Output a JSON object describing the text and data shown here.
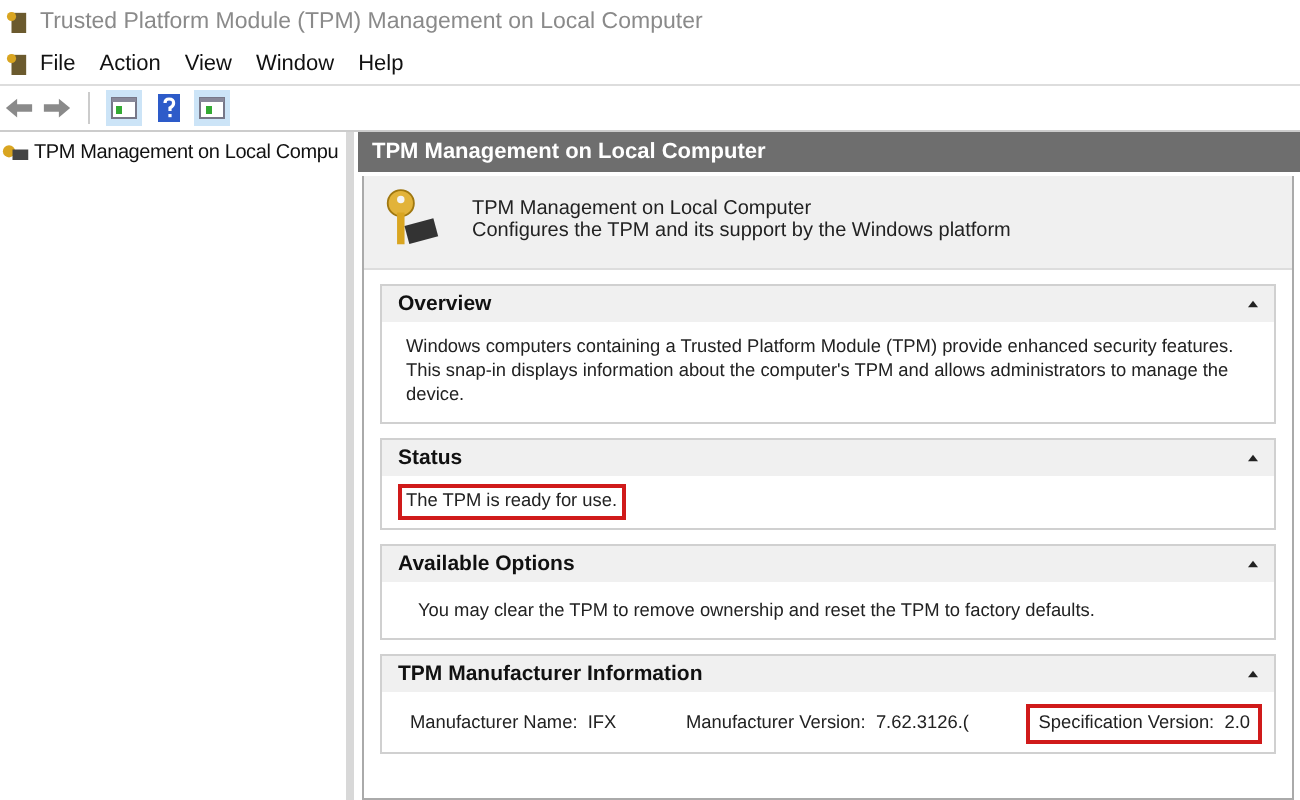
{
  "window": {
    "title": "Trusted Platform Module (TPM) Management on Local Computer"
  },
  "menu": [
    "File",
    "Action",
    "View",
    "Window",
    "Help"
  ],
  "tree": {
    "items": [
      {
        "label": "TPM Management on Local Compu",
        "selected": false
      }
    ]
  },
  "pane": {
    "header": "TPM Management on Local Computer",
    "info_title": "TPM Management on Local Computer",
    "info_subtitle": "Configures the TPM and its support by the Windows platform"
  },
  "sections": [
    {
      "title": "Overview",
      "expanded": true,
      "kind": "text",
      "text": "Windows computers containing a Trusted Platform Module (TPM) provide enhanced security features. This snap-in displays information about the computer's TPM and allows administrators to manage the device.",
      "highlighted": false
    },
    {
      "title": "Status",
      "expanded": true,
      "kind": "text",
      "text": "The TPM is ready for use.",
      "highlighted": true
    },
    {
      "title": "Available Options",
      "expanded": true,
      "kind": "option",
      "text": "You may clear the TPM to remove ownership and reset the TPM to factory defaults.",
      "highlighted": false
    },
    {
      "title": "TPM Manufacturer Information",
      "expanded": true,
      "kind": "fields",
      "fields": [
        {
          "label": "Manufacturer Name:",
          "value": "IFX",
          "highlighted": false
        },
        {
          "label": "Manufacturer Version:",
          "value": "7.62.3126.(",
          "highlighted": false
        },
        {
          "label": "Specification Version:",
          "value": "2.0",
          "highlighted": true
        }
      ]
    }
  ]
}
